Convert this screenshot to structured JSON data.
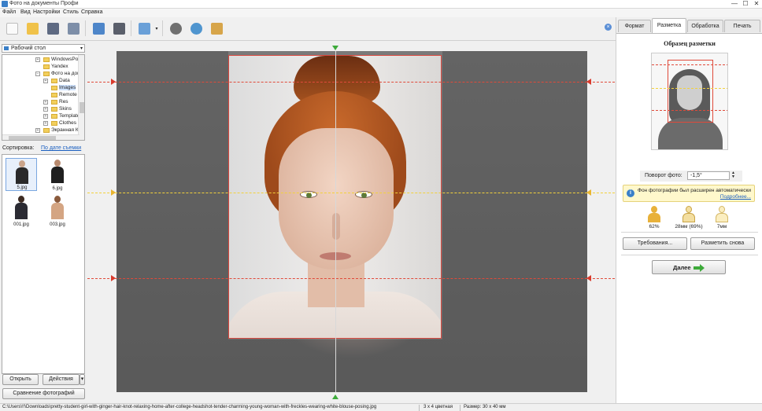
{
  "window": {
    "title": "Фото на документы Профи",
    "minimize": "—",
    "maximize": "☐",
    "close": "✕"
  },
  "menu": [
    "Файл",
    "Вид",
    "Настройки",
    "Стиль",
    "Справка"
  ],
  "toolbar": {
    "icons": [
      "new-file-icon",
      "open-folder-icon",
      "save-icon",
      "print-icon",
      "user-photo-icon",
      "camera-icon",
      "wallpaper-icon",
      "film-reel-icon",
      "globe-upload-icon",
      "package-icon"
    ],
    "panel_close": "×"
  },
  "left": {
    "folder": "Рабочий стол",
    "tree": [
      {
        "label": "WindowsPow",
        "level": 1,
        "expander": "+"
      },
      {
        "label": "Yandex",
        "level": 1,
        "expander": ""
      },
      {
        "label": "Фото на док",
        "level": 1,
        "expander": "−"
      },
      {
        "label": "Data",
        "level": 2,
        "expander": "+"
      },
      {
        "label": "Images",
        "level": 2,
        "expander": "",
        "selected": true
      },
      {
        "label": "Remote",
        "level": 2,
        "expander": ""
      },
      {
        "label": "Res",
        "level": 2,
        "expander": "+"
      },
      {
        "label": "Skins",
        "level": 2,
        "expander": "+"
      },
      {
        "label": "Template",
        "level": 2,
        "expander": "+"
      },
      {
        "label": "Clothes",
        "level": 2,
        "expander": "+"
      },
      {
        "label": "Экранная Ка",
        "level": 1,
        "expander": "+"
      }
    ],
    "sort_label": "Сортировка:",
    "sort_value": "По дате съемки",
    "thumbnails": [
      {
        "name": "5.jpg",
        "selected": true
      },
      {
        "name": "6.jpg"
      },
      {
        "name": "001.jpg"
      },
      {
        "name": "003.jpg"
      }
    ],
    "open_button": "Открыть",
    "actions_button": "Действия",
    "actions_dropdown": "▾",
    "compare_button": "Сравнение фотографий"
  },
  "tabs": [
    "Формат",
    "Разметка",
    "Обработка",
    "Печать"
  ],
  "active_tab": 1,
  "right": {
    "sample_title": "Образец разметки",
    "rotation_label": "Поворот фото:",
    "rotation_value": "-1,5°",
    "spin_up": "▲",
    "spin_down": "▼",
    "info_icon": "i",
    "info_text": "Фон фотографии был расширен автоматически",
    "info_link": "Подробнее...",
    "stats": [
      "62%",
      "28мм (69%)",
      "7мм"
    ],
    "requirements_button": "Требования...",
    "remark_button": "Разметить снова",
    "next_button": "Далее"
  },
  "colors": {
    "guide_red": "#e04a3a",
    "guide_yellow": "#f2d13c",
    "marker_green": "#3daa3a",
    "accent_blue": "#3a7fc8"
  },
  "status": {
    "path": "C:\\Users\\!!\\Downloads\\pretty-student-girl-with-ginger-hair-knot-relaxing-home-after-college-headshot-tender-charming-young-woman-with-freckles-wearing-white-blouse-posing.jpg",
    "format": "3 x 4 цветная",
    "size": "Размер: 30 x 40 мм"
  }
}
